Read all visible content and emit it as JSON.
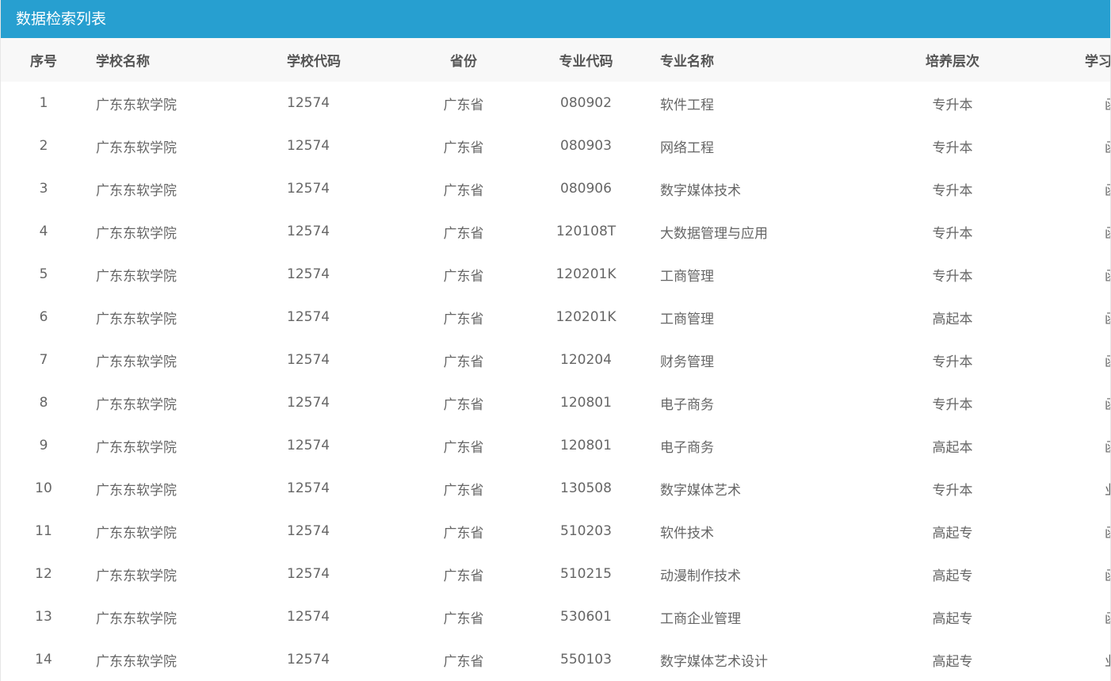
{
  "panel": {
    "title": "数据检索列表"
  },
  "table": {
    "headers": [
      "序号",
      "学校名称",
      "学校代码",
      "省份",
      "专业代码",
      "专业名称",
      "培养层次",
      "学习形式"
    ],
    "rows": [
      [
        "1",
        "广东东软学院",
        "12574",
        "广东省",
        "080902",
        "软件工程",
        "专升本",
        "函授"
      ],
      [
        "2",
        "广东东软学院",
        "12574",
        "广东省",
        "080903",
        "网络工程",
        "专升本",
        "函授"
      ],
      [
        "3",
        "广东东软学院",
        "12574",
        "广东省",
        "080906",
        "数字媒体技术",
        "专升本",
        "函授"
      ],
      [
        "4",
        "广东东软学院",
        "12574",
        "广东省",
        "120108T",
        "大数据管理与应用",
        "专升本",
        "函授"
      ],
      [
        "5",
        "广东东软学院",
        "12574",
        "广东省",
        "120201K",
        "工商管理",
        "专升本",
        "函授"
      ],
      [
        "6",
        "广东东软学院",
        "12574",
        "广东省",
        "120201K",
        "工商管理",
        "高起本",
        "函授"
      ],
      [
        "7",
        "广东东软学院",
        "12574",
        "广东省",
        "120204",
        "财务管理",
        "专升本",
        "函授"
      ],
      [
        "8",
        "广东东软学院",
        "12574",
        "广东省",
        "120801",
        "电子商务",
        "专升本",
        "函授"
      ],
      [
        "9",
        "广东东软学院",
        "12574",
        "广东省",
        "120801",
        "电子商务",
        "高起本",
        "函授"
      ],
      [
        "10",
        "广东东软学院",
        "12574",
        "广东省",
        "130508",
        "数字媒体艺术",
        "专升本",
        "业余"
      ],
      [
        "11",
        "广东东软学院",
        "12574",
        "广东省",
        "510203",
        "软件技术",
        "高起专",
        "函授"
      ],
      [
        "12",
        "广东东软学院",
        "12574",
        "广东省",
        "510215",
        "动漫制作技术",
        "高起专",
        "函授"
      ],
      [
        "13",
        "广东东软学院",
        "12574",
        "广东省",
        "530601",
        "工商企业管理",
        "高起专",
        "函授"
      ],
      [
        "14",
        "广东东软学院",
        "12574",
        "广东省",
        "550103",
        "数字媒体艺术设计",
        "高起专",
        "业余"
      ]
    ]
  },
  "colors": {
    "header_bg": "#279fd0",
    "header_text": "#ffffff",
    "table_head_bg": "#f8f8f8",
    "cell_text": "#666666"
  }
}
